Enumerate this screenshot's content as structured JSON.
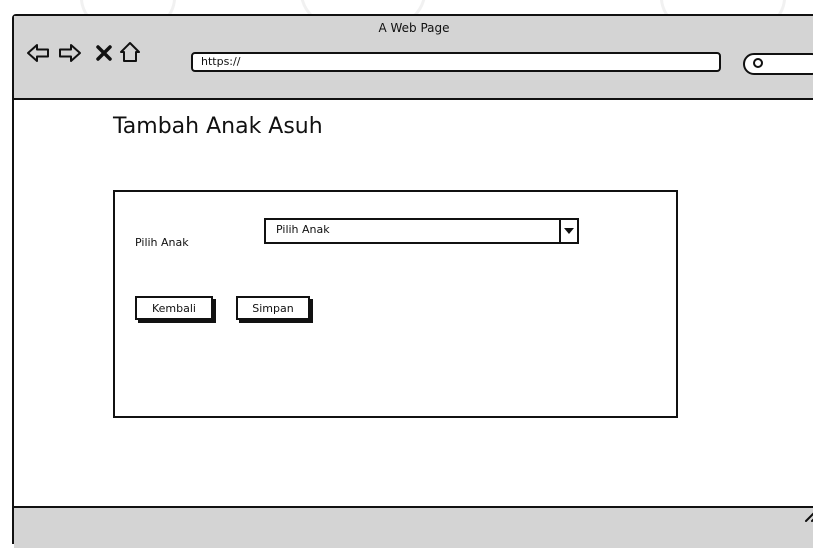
{
  "window": {
    "title": "A Web Page",
    "url": "https://"
  },
  "icons": {
    "back": "back-arrow-icon",
    "forward": "forward-arrow-icon",
    "stop": "close-icon",
    "home": "home-icon",
    "search": "search-icon",
    "resize": "resize-grip-icon"
  },
  "page": {
    "title": "Tambah Anak Asuh"
  },
  "form": {
    "child_label": "Pilih Anak",
    "child_select_value": "Pilih Anak",
    "back_button": "Kembali",
    "save_button": "Simpan"
  },
  "colors": {
    "chrome_gray": "#d4d4d4",
    "stroke": "#111111",
    "background": "#ffffff"
  }
}
